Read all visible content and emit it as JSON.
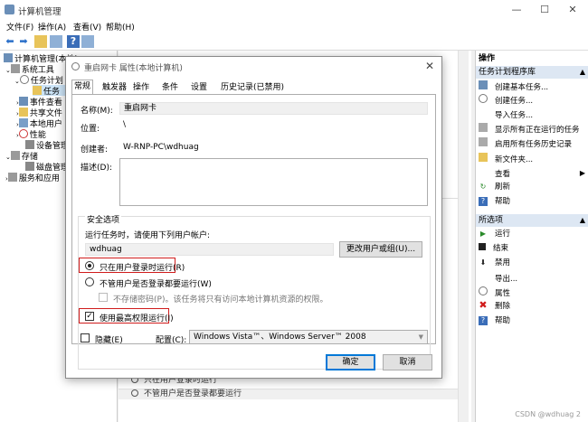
{
  "window": {
    "title": "计算机管理"
  },
  "menu": [
    "文件(F)",
    "操作(A)",
    "查看(V)",
    "帮助(H)"
  ],
  "tree": {
    "items": [
      {
        "label": "计算机管理(本地)",
        "icon": "computer-icon"
      },
      {
        "label": "系统工具",
        "icon": "tools-icon"
      },
      {
        "label": "任务计划",
        "icon": "clock-icon"
      },
      {
        "label": "任务",
        "icon": "folder-icon"
      },
      {
        "label": "事件查看",
        "icon": "event-icon"
      },
      {
        "label": "共享文件",
        "icon": "share-icon"
      },
      {
        "label": "本地用户",
        "icon": "users-icon"
      },
      {
        "label": "性能",
        "icon": "performance-icon"
      },
      {
        "label": "设备管理",
        "icon": "device-icon"
      },
      {
        "label": "存储",
        "icon": "storage-icon"
      },
      {
        "label": "磁盘管理",
        "icon": "disk-icon"
      },
      {
        "label": "服务和应用",
        "icon": "services-icon"
      }
    ]
  },
  "actions": {
    "header": "操作",
    "section1": "任务计划程序库",
    "items1": [
      "创建基本任务...",
      "创建任务...",
      "导入任务...",
      "显示所有正在运行的任务",
      "启用所有任务历史记录",
      "新文件夹...",
      "查看",
      "刷新",
      "帮助"
    ],
    "section2": "所选项",
    "items2": [
      "运行",
      "结束",
      "禁用",
      "导出...",
      "属性",
      "删除",
      "帮助"
    ]
  },
  "behind": {
    "line1": "只在用户登录时运行",
    "line2": "不管用户是否登录都要运行"
  },
  "dialog": {
    "title": "重启网卡 属性(本地计算机)",
    "tabs": [
      "常规",
      "触发器",
      "操作",
      "条件",
      "设置",
      "历史记录(已禁用)"
    ],
    "name_label": "名称(M):",
    "name_value": "重启网卡",
    "location_label": "位置:",
    "location_value": "\\",
    "author_label": "创建者:",
    "author_value": "W-RNP-PC\\wdhuag",
    "desc_label": "描述(D):",
    "security_title": "安全选项",
    "run_as_prompt": "运行任务时，请使用下列用户帐户:",
    "user_value": "wdhuag",
    "change_user_button": "更改用户或组(U)...",
    "radio_logged_on": "只在用户登录时运行(R)",
    "radio_whether": "不管用户是否登录都要运行(W)",
    "no_store_pwd": "不存储密码(P)。该任务将只有访问本地计算机资源的权限。",
    "highest_priv": "使用最高权限运行(I)",
    "hidden": "隐藏(E)",
    "config_label": "配置(C):",
    "config_value": "Windows Vista™、Windows Server™ 2008",
    "ok": "确定",
    "cancel": "取消"
  },
  "watermark": "CSDN @wdhuag 2"
}
